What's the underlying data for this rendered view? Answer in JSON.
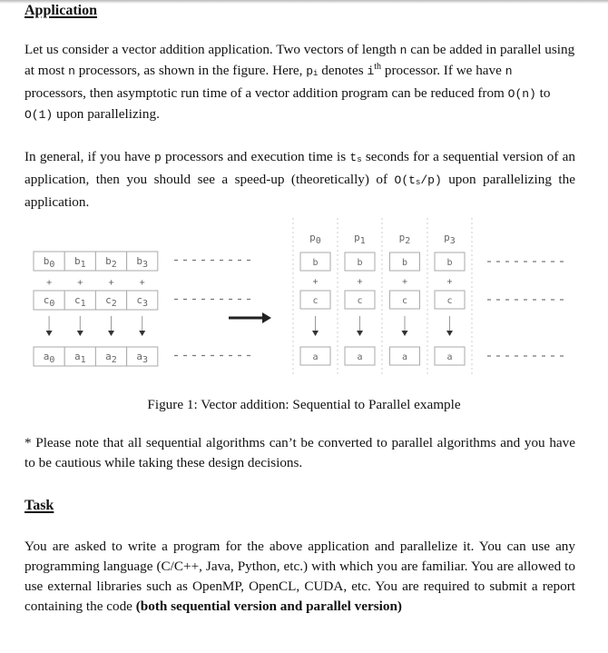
{
  "sections": {
    "application": {
      "heading": "Application",
      "p1": {
        "s1": "Let us consider a vector addition application. Two vectors of length ",
        "n1": "n",
        "s2": " can be added in parallel using at most ",
        "n2": "n",
        "s3": " processors, as shown in the figure. Here, ",
        "pi_base": "p",
        "pi_sub": "i",
        "s4": " denotes ",
        "ith_base": "i",
        "ith_sup": "th",
        "s5": " processor. If we have ",
        "n3": "n",
        "s6": " processors, then asymptotic run time of a vector addition program can be reduced from ",
        "on": "O(n)",
        "s7": " to ",
        "o1": "O(1)",
        "s8": "  upon parallelizing."
      },
      "p2": {
        "s1": "In general, if you have ",
        "p": "p",
        "s2": " processors and execution time is ",
        "ts_base": "t",
        "ts_sub": "s",
        "s3": " seconds for a sequential version of an application, then you should see a speed-up (theoretically) of ",
        "speedup_a": "O(t",
        "speedup_sub": "s",
        "speedup_b": "/p)",
        "s4": "  upon parallelizing the application."
      }
    },
    "figure": {
      "caption": "Figure 1: Vector addition: Sequential to Parallel example",
      "sequential": {
        "b_row": [
          {
            "base": "b",
            "idx": "0"
          },
          {
            "base": "b",
            "idx": "1"
          },
          {
            "base": "b",
            "idx": "2"
          },
          {
            "base": "b",
            "idx": "3"
          }
        ],
        "c_row": [
          {
            "base": "c",
            "idx": "0"
          },
          {
            "base": "c",
            "idx": "1"
          },
          {
            "base": "c",
            "idx": "2"
          },
          {
            "base": "c",
            "idx": "3"
          }
        ],
        "a_row": [
          {
            "base": "a",
            "idx": "0"
          },
          {
            "base": "a",
            "idx": "1"
          },
          {
            "base": "a",
            "idx": "2"
          },
          {
            "base": "a",
            "idx": "3"
          }
        ],
        "operator": "+",
        "continuation": "- - - - - - - -"
      },
      "parallel": {
        "processors": [
          {
            "base": "P",
            "idx": "0"
          },
          {
            "base": "P",
            "idx": "1"
          },
          {
            "base": "P",
            "idx": "2"
          },
          {
            "base": "P",
            "idx": "3"
          }
        ],
        "b_label": "b",
        "c_label": "c",
        "a_label": "a",
        "operator": "+",
        "continuation": "- - - - - - - -"
      }
    },
    "note": "* Please note that all sequential algorithms can’t be converted to parallel algorithms and you have to be cautious while taking these design decisions.",
    "task": {
      "heading": "Task",
      "text": "You are asked to write a program for the above application and parallelize it. You can use any programming language (C/C++, Java, Python, etc.) with which you are familiar. You are allowed to use external libraries such as OpenMP, OpenCL, CUDA, etc. You are required to submit a report containing the code ",
      "bold": "(both sequential version and parallel version)"
    }
  }
}
